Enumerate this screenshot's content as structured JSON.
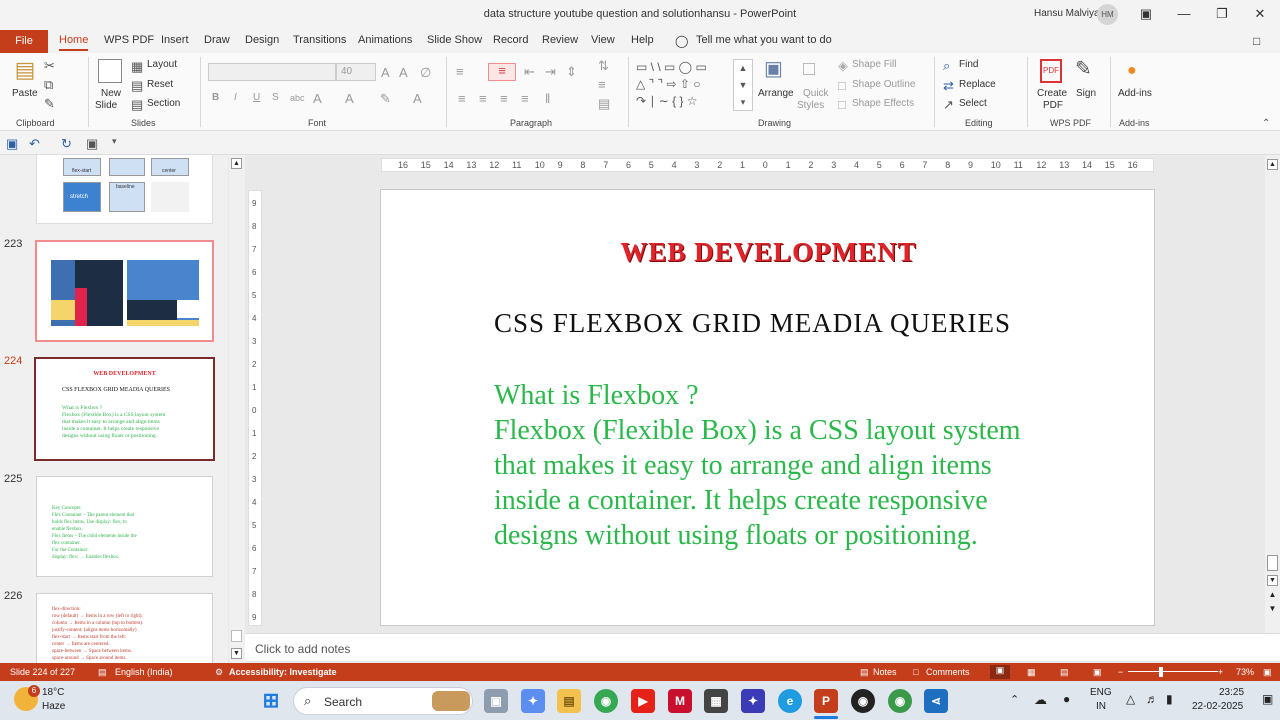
{
  "window": {
    "title": "data structure youtube question and solutionhansu  -  PowerPoint",
    "user": "Hansu Malviya",
    "avatar_initials": "HM"
  },
  "tabs": {
    "file": "File",
    "items": [
      "Home",
      "WPS PDF",
      "Insert",
      "Draw",
      "Design",
      "Transitions",
      "Animations",
      "Slide Show",
      "Record",
      "Review",
      "View",
      "Help"
    ],
    "tell_me": "Tell me what you want to do"
  },
  "ribbon": {
    "clipboard": {
      "paste": "Paste",
      "label": "Clipboard"
    },
    "slides": {
      "new_slide_1": "New",
      "new_slide_2": "Slide",
      "layout": "Layout",
      "reset": "Reset",
      "section": "Section",
      "label": "Slides"
    },
    "font": {
      "size": "40",
      "label": "Font",
      "bold": "B",
      "italic": "I",
      "underline": "U",
      "strike": "S",
      "abc": "abc"
    },
    "paragraph": {
      "label": "Paragraph"
    },
    "drawing": {
      "arrange_1": "Arrange",
      "quick_styles_1": "Quick",
      "quick_styles_2": "Styles",
      "shape_fill": "Shape Fill",
      "shape_outline": "Shape Outline",
      "shape_effects": "Shape Effects",
      "label": "Drawing"
    },
    "editing": {
      "find": "Find",
      "replace": "Replace",
      "select": "Select",
      "label": "Editing"
    },
    "wps_pdf": {
      "create_1": "Create",
      "create_2": "PDF",
      "sign": "Sign",
      "label": "WPS PDF"
    },
    "addins": {
      "addins": "Add-ins",
      "label": "Add-ins"
    }
  },
  "slides_panel": {
    "thumb_222": {
      "labels": [
        "flex-start",
        "center",
        "stretch",
        "baseline"
      ]
    },
    "items": [
      {
        "num": "223"
      },
      {
        "num": "224",
        "heading": "WEB DEVELOPMENT",
        "subheading": "CSS FLEXBOX GRID MEADIA QUERIES",
        "body": "What is Flexbox ?\nFlexbox (Flexible Box) is a CSS layout system\nthat makes it easy to arrange and align items\ninside a container. It helps create responsive\ndesigns without using floats or positioning."
      },
      {
        "num": "225",
        "body": "Key Concepts:\nFlex Container – The parent element that\nholds flex items. Use display: flex; to\nenable flexbox.\nFlex Items – The child elements inside the\nflex container.\nFor the Container:\ndisplay: flex; → Enables flexbox."
      },
      {
        "num": "226",
        "body": "flex-direction:\nrow (default) → Items in a row (left to right).\ncolumn → Items in a column (top to bottom).\njustify-content: (aligns items horizontally)\nflex-start → Items start from the left.\ncenter → Items are centered.\nspace-between → Space between items.\nspace-around → Space around items."
      }
    ]
  },
  "ruler": {
    "h_ticks": [
      "16",
      "15",
      "14",
      "13",
      "12",
      "11",
      "10",
      "9",
      "8",
      "7",
      "6",
      "5",
      "4",
      "3",
      "2",
      "1",
      "0",
      "1",
      "2",
      "3",
      "4",
      "5",
      "6",
      "7",
      "8",
      "9",
      "10",
      "11",
      "12",
      "13",
      "14",
      "15",
      "16"
    ],
    "v_ticks": [
      "9",
      "8",
      "7",
      "6",
      "5",
      "4",
      "3",
      "2",
      "1",
      "0",
      "1",
      "2",
      "3",
      "4",
      "5",
      "6",
      "7",
      "8",
      "9"
    ]
  },
  "slide": {
    "heading": "WEB DEVELOPMENT",
    "subheading": "CSS FLEXBOX GRID MEADIA QUERIES",
    "body_lines": [
      "What is Flexbox ?",
      "Flexbox (Flexible Box) is a CSS layout system",
      "that makes it easy to arrange and align items",
      "inside a container. It helps create responsive",
      "designs without using floats or positioning."
    ]
  },
  "notes": {
    "placeholder": "Click to add notes"
  },
  "status": {
    "slide_count": "Slide 224 of 227",
    "language": "English (India)",
    "accessibility": "Accessibility: Investigate",
    "notes": "Notes",
    "comments": "Comments",
    "zoom": "73%"
  },
  "taskbar": {
    "weather_temp": "18°C",
    "weather_desc": "Haze",
    "weather_badge": "6",
    "search": "Search",
    "lang_1": "ENG",
    "lang_2": "IN",
    "time": "23:25",
    "date": "22-02-2025"
  },
  "colors": {
    "accent": "#c43e1c",
    "heading_red": "#e1242a",
    "body_green": "#2ab84a"
  }
}
